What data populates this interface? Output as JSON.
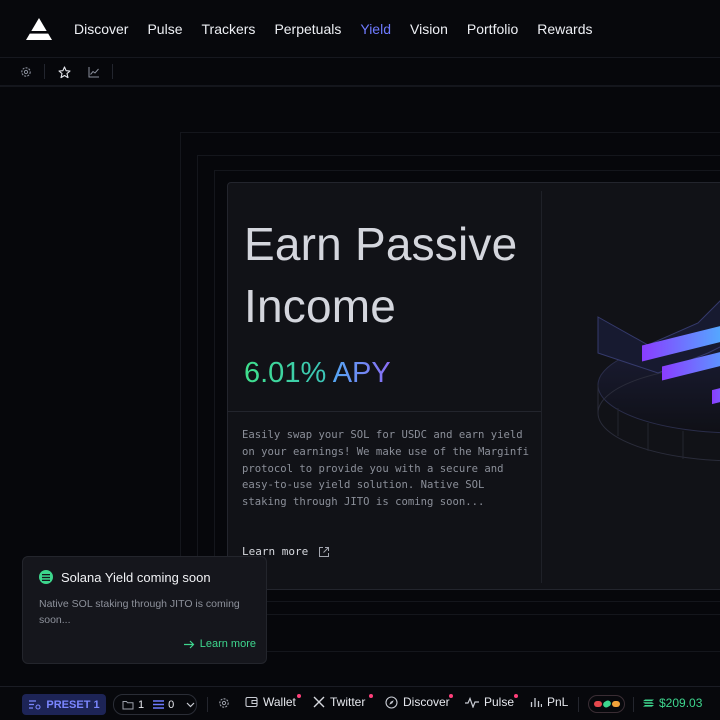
{
  "nav": {
    "items": [
      {
        "label": "Discover",
        "active": false
      },
      {
        "label": "Pulse",
        "active": false
      },
      {
        "label": "Trackers",
        "active": false
      },
      {
        "label": "Perpetuals",
        "active": false
      },
      {
        "label": "Yield",
        "active": true
      },
      {
        "label": "Vision",
        "active": false
      },
      {
        "label": "Portfolio",
        "active": false
      },
      {
        "label": "Rewards",
        "active": false
      }
    ],
    "active_color": "#6f7bff"
  },
  "subbar": {
    "icons": [
      "settings-icon",
      "star-icon",
      "chart-icon"
    ]
  },
  "hero": {
    "title": "Earn Passive Income",
    "apy_value": "6.01%",
    "apy_label": "APY",
    "description": "Easily swap your SOL for USDC and earn yield on your earnings! We make use of the Marginfi protocol to provide you with a secure and easy-to-use yield solution. Native SOL staking through JITO is coming soon...",
    "learn_more": "Learn more"
  },
  "toast": {
    "title": "Solana Yield coming soon",
    "body": "Native SOL staking through JITO is coming soon...",
    "link": "Learn more",
    "accent": "#3ed68e"
  },
  "bottombar": {
    "preset": "PRESET 1",
    "counter_left": "1",
    "counter_right": "0",
    "wallet": "Wallet",
    "twitter": "Twitter",
    "discover": "Discover",
    "pulse": "Pulse",
    "pnl": "PnL",
    "balance": "$209.03",
    "balance_color": "#3ed68e"
  }
}
